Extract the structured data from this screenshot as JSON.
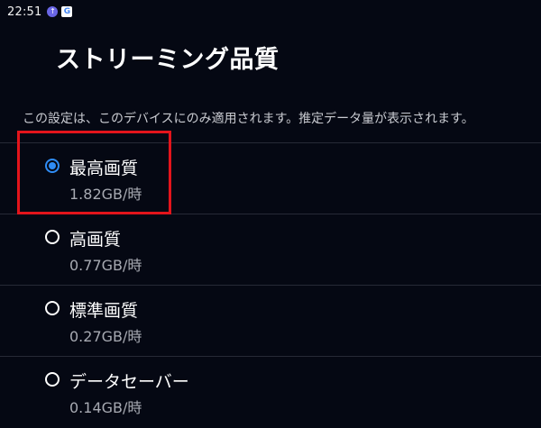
{
  "status_bar": {
    "time": "22:51",
    "icons": [
      "upload-notification-icon",
      "google-icon"
    ]
  },
  "header": {
    "title": "ストリーミング品質"
  },
  "description": "この設定は、このデバイスにのみ適用されます。推定データ量が表示されます。",
  "options": [
    {
      "label": "最高画質",
      "sub": "1.82GB/時",
      "selected": true
    },
    {
      "label": "高画質",
      "sub": "0.77GB/時",
      "selected": false
    },
    {
      "label": "標準画質",
      "sub": "0.27GB/時",
      "selected": false
    },
    {
      "label": "データセーバー",
      "sub": "0.14GB/時",
      "selected": false
    }
  ],
  "colors": {
    "background": "#050813",
    "accent": "#2f8cf5",
    "highlight": "#e3141b"
  }
}
